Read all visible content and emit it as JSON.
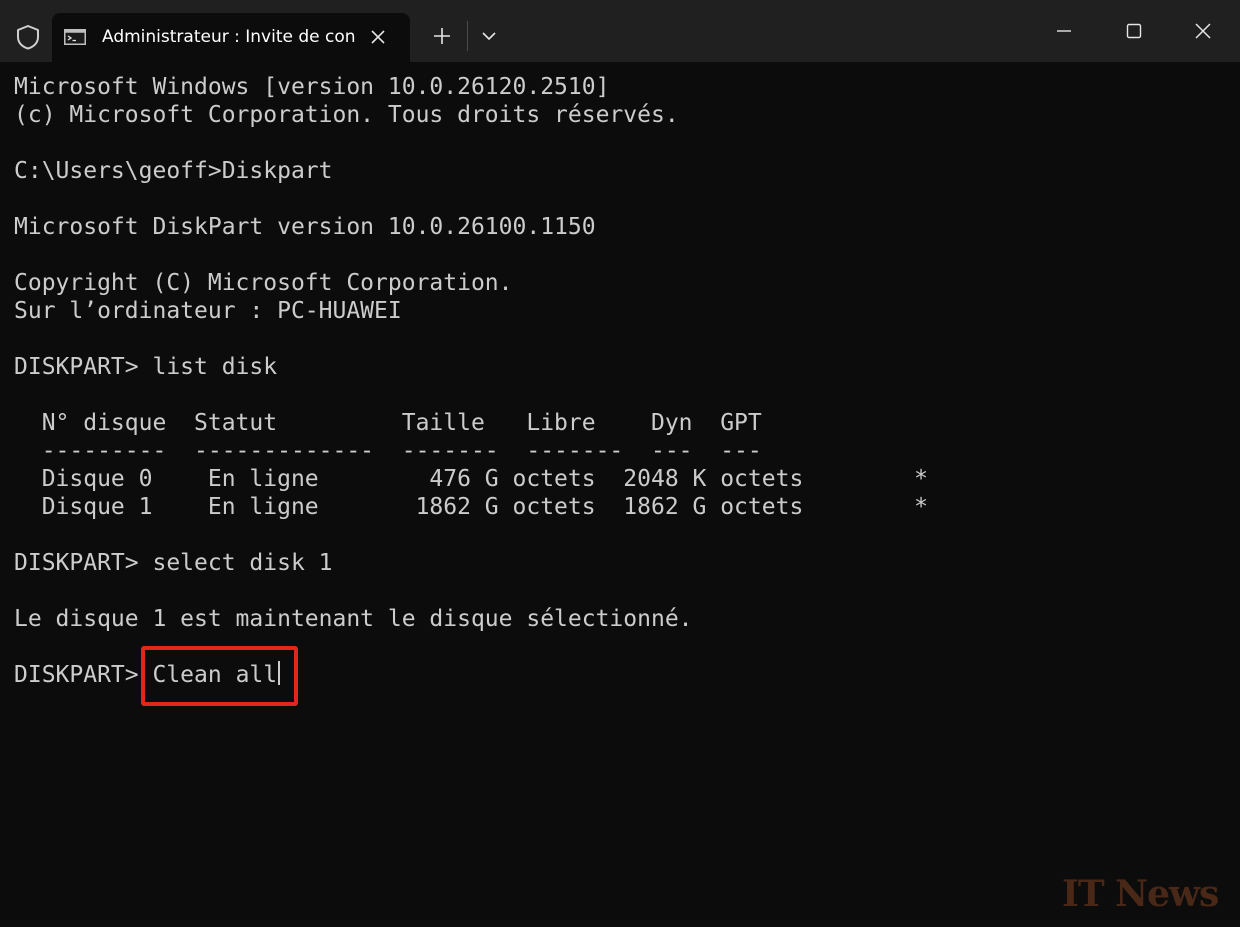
{
  "window": {
    "tab_title": "Administrateur : Invite de con",
    "icons": {
      "shield": "shield-icon",
      "tab": "command-prompt-icon",
      "tab_close": "close-icon",
      "new_tab": "plus-icon",
      "dropdown": "chevron-down-icon",
      "minimize": "minimize-icon",
      "maximize": "maximize-icon",
      "close": "close-icon"
    }
  },
  "console": {
    "lines": [
      "Microsoft Windows [version 10.0.26120.2510]",
      "(c) Microsoft Corporation. Tous droits réservés.",
      "C:\\Users\\geoff>Diskpart",
      "Microsoft DiskPart version 10.0.26100.1150",
      "Copyright (C) Microsoft Corporation.",
      "Sur l’ordinateur : PC-HUAWEI",
      "DISKPART> list disk",
      "  N° disque  Statut         Taille   Libre    Dyn  GPT",
      "  ---------  -------------  -------  -------  ---  ---",
      "  Disque 0    En ligne        476 G octets  2048 K octets        *",
      "  Disque 1    En ligne       1862 G octets  1862 G octets        *",
      "DISKPART> select disk 1",
      "Le disque 1 est maintenant le disque sélectionné."
    ],
    "prompt": "DISKPART> ",
    "current_input": "Clean all"
  },
  "watermark": "IT News",
  "colors": {
    "console_bg": "#0c0c0c",
    "titlebar_bg": "#202020",
    "text": "#cccccc",
    "highlight_border": "#e0281a"
  }
}
